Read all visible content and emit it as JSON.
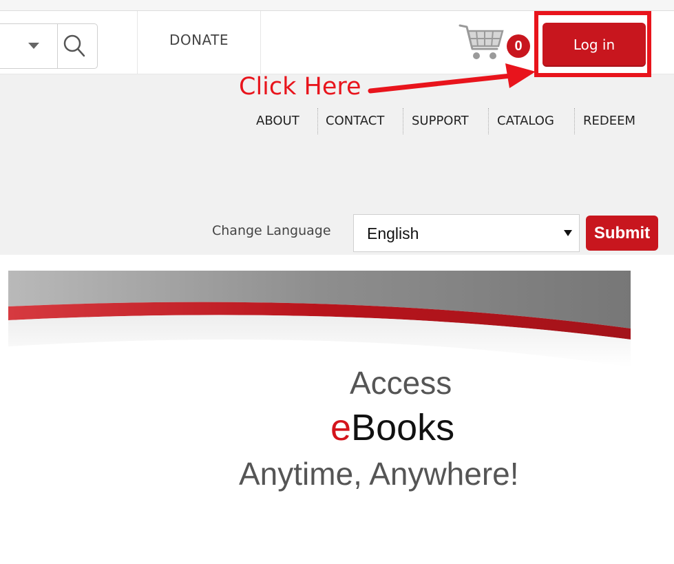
{
  "header": {
    "donate_label": "DONATE",
    "cart_count": "0",
    "login_label": "Log in"
  },
  "annotation": {
    "text": "Click Here"
  },
  "nav": {
    "items": [
      "ABOUT",
      "CONTACT",
      "SUPPORT",
      "CATALOG",
      "REDEEM"
    ]
  },
  "language": {
    "label": "Change Language",
    "selected": "English",
    "submit_label": "Submit"
  },
  "banner": {
    "line1": "Access",
    "line2_accent": "e",
    "line2_rest": "Books",
    "line3": "Anytime, Anywhere!"
  },
  "colors": {
    "brand_red": "#c8161e",
    "annotation_red": "#e8141c"
  }
}
